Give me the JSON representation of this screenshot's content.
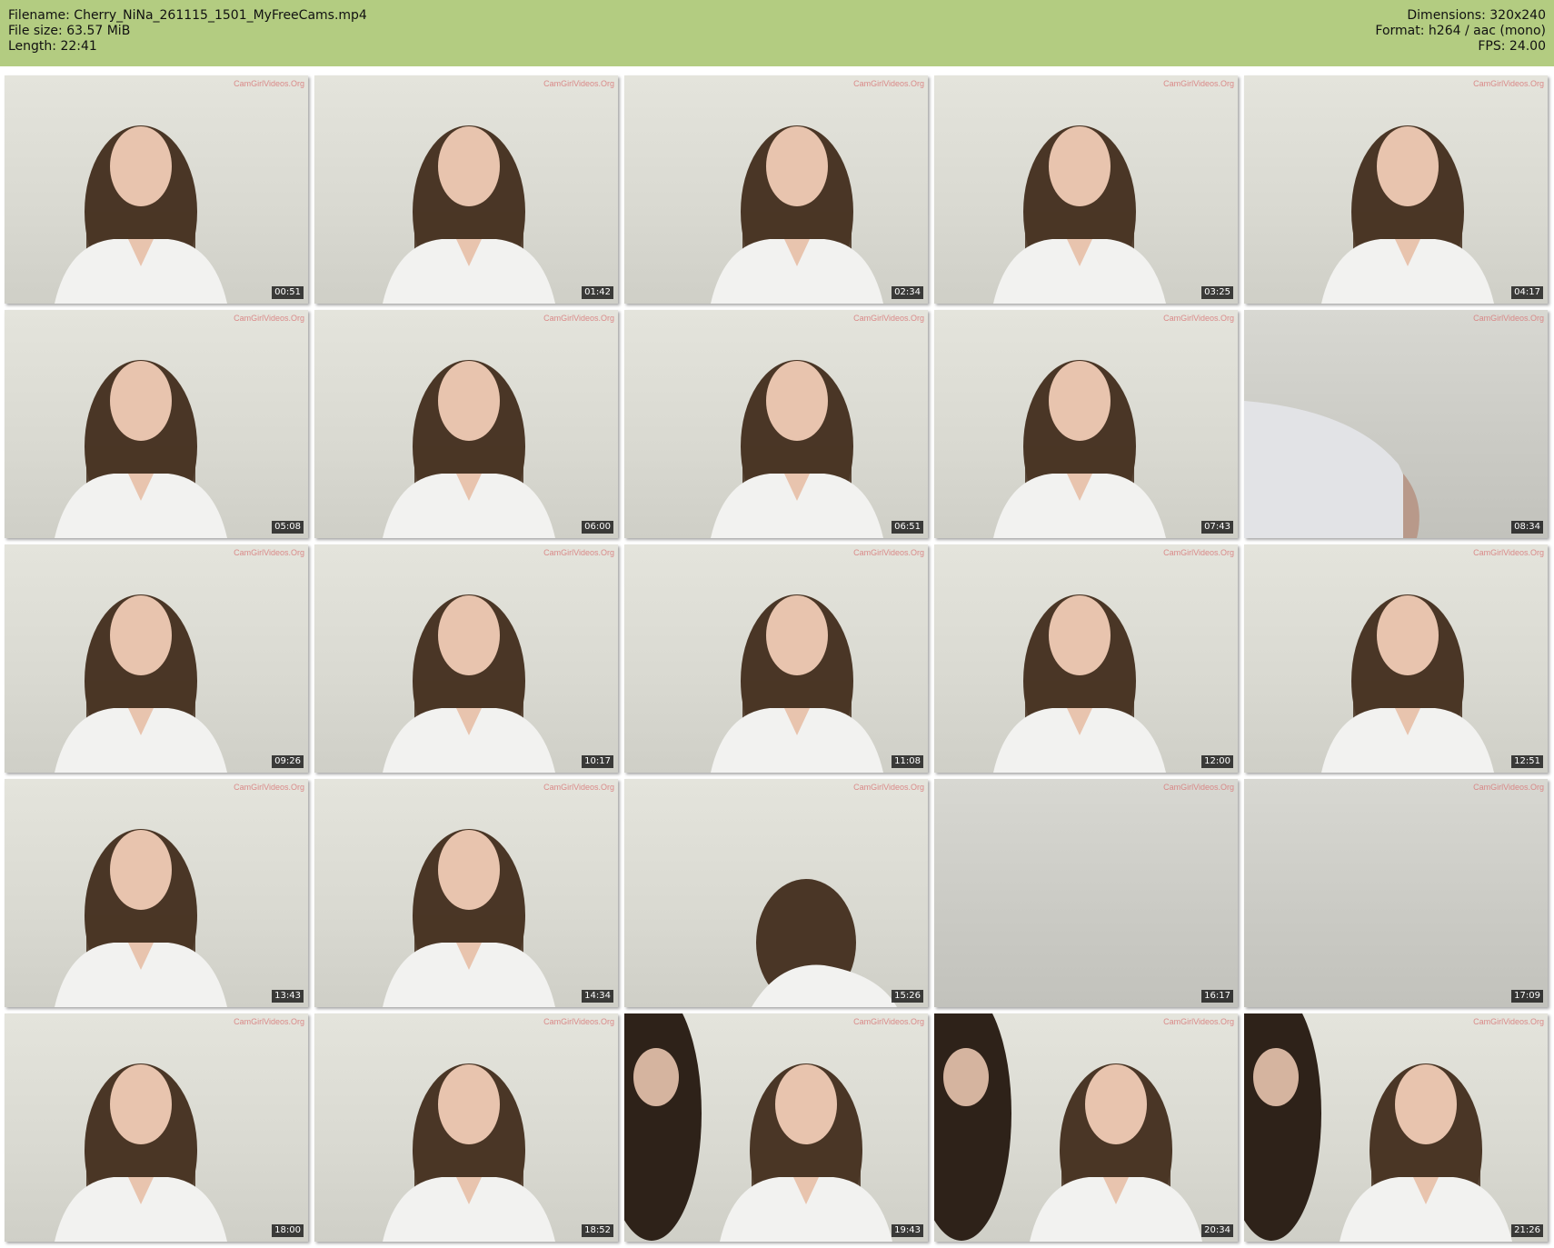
{
  "header": {
    "filename_label": "Filename: Cherry_NiNa_261115_1501_MyFreeCams.mp4",
    "filesize_label": "File size: 63.57 MiB",
    "length_label": "Length: 22:41",
    "dimensions_label": "Dimensions: 320x240",
    "format_label": "Format: h264 / aac (mono)",
    "fps_label": "FPS: 24.00"
  },
  "watermark_text": "CamGirlVideos.Org",
  "colors": {
    "header_bg": "#b3cc81",
    "shirt": "#f2f2f0",
    "hair": "#4a3626",
    "skin": "#e8c4ae"
  },
  "thumbnails": [
    {
      "time": "00:51",
      "scene": "girl"
    },
    {
      "time": "01:42",
      "scene": "girl"
    },
    {
      "time": "02:34",
      "scene": "girl"
    },
    {
      "time": "03:25",
      "scene": "girl"
    },
    {
      "time": "04:17",
      "scene": "girl"
    },
    {
      "time": "05:08",
      "scene": "girl"
    },
    {
      "time": "06:00",
      "scene": "girl"
    },
    {
      "time": "06:51",
      "scene": "girl"
    },
    {
      "time": "07:43",
      "scene": "girl"
    },
    {
      "time": "08:34",
      "scene": "blur"
    },
    {
      "time": "09:26",
      "scene": "girl"
    },
    {
      "time": "10:17",
      "scene": "girl"
    },
    {
      "time": "11:08",
      "scene": "girl"
    },
    {
      "time": "12:00",
      "scene": "girl"
    },
    {
      "time": "12:51",
      "scene": "girl"
    },
    {
      "time": "13:43",
      "scene": "girl"
    },
    {
      "time": "14:34",
      "scene": "girl"
    },
    {
      "time": "15:26",
      "scene": "leaning"
    },
    {
      "time": "16:17",
      "scene": "empty"
    },
    {
      "time": "17:09",
      "scene": "empty"
    },
    {
      "time": "18:00",
      "scene": "girl"
    },
    {
      "time": "18:52",
      "scene": "girl"
    },
    {
      "time": "19:43",
      "scene": "two"
    },
    {
      "time": "20:34",
      "scene": "two"
    },
    {
      "time": "21:26",
      "scene": "two"
    }
  ]
}
